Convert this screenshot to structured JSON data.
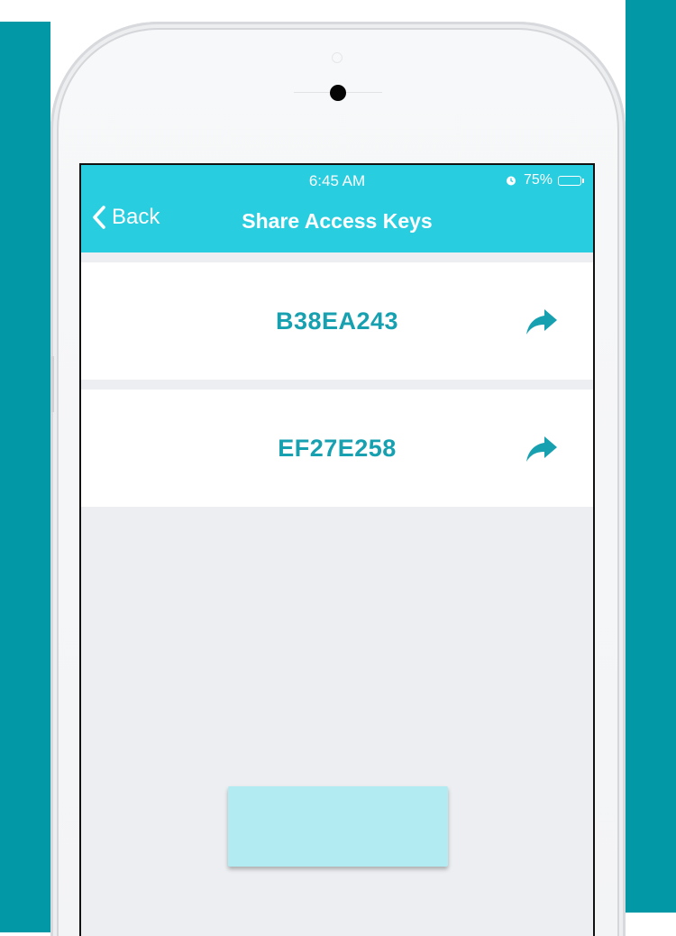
{
  "status_bar": {
    "time": "6:45 AM",
    "battery_percent_label": "75%",
    "battery_level": 0.75,
    "alarm_icon": "alarm-clock-icon"
  },
  "navbar": {
    "back_label": "Back",
    "back_icon": "chevron-left-icon",
    "title": "Share Access Keys"
  },
  "keys": [
    {
      "code": "B38EA243",
      "action_icon": "share-arrow-icon"
    },
    {
      "code": "EF27E258",
      "action_icon": "share-arrow-icon"
    }
  ],
  "colors": {
    "background_teal": "#0298a6",
    "navbar": "#29cde0",
    "key_text": "#17a1b0",
    "share_icon": "#17a1b0",
    "screen_background": "#eceef1",
    "action_button": "#b3ebf3"
  }
}
